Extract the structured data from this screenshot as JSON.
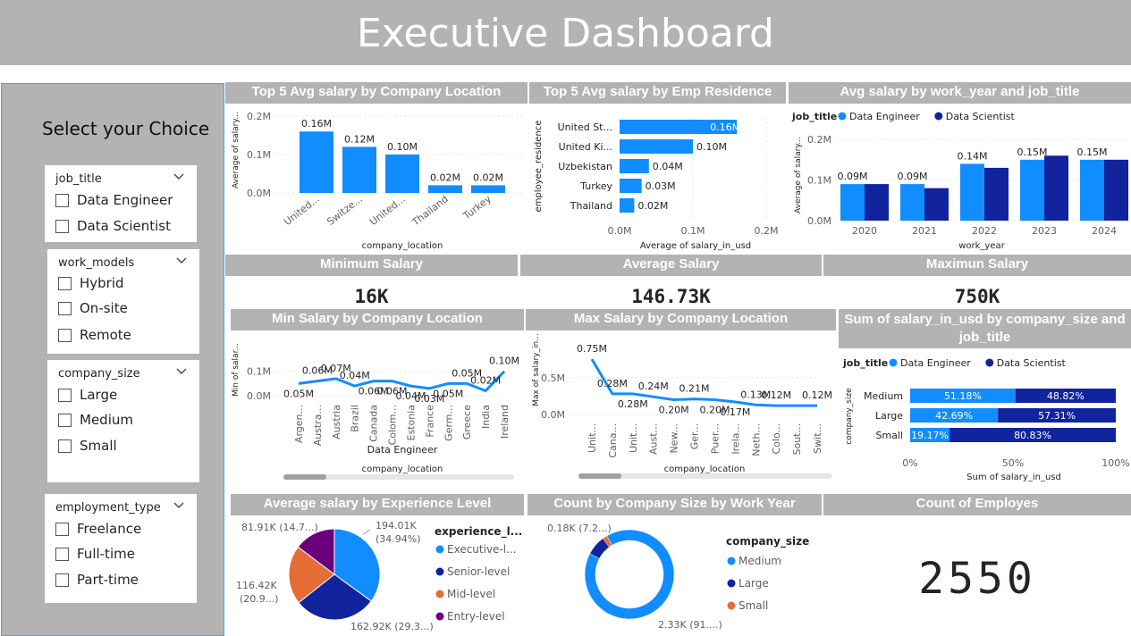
{
  "page": {
    "title": "Executive Dashboard"
  },
  "colors": {
    "primary": "#118dff",
    "dark": "#12239e",
    "orange": "#e66c37",
    "purple": "#6b007b",
    "header_bg": "#b3b3b3"
  },
  "sidebar": {
    "heading": "Select your Choice",
    "slicers": [
      {
        "title": "job_title",
        "options": [
          "Data Engineer",
          "Data Scientist"
        ]
      },
      {
        "title": "work_models",
        "options": [
          "Hybrid",
          "On-site",
          "Remote"
        ]
      },
      {
        "title": "company_size",
        "options": [
          "Large",
          "Medium",
          "Small"
        ]
      },
      {
        "title": "employment_type",
        "options": [
          "Freelance",
          "Full-time",
          "Part-time"
        ]
      }
    ]
  },
  "headers": {
    "top_loc": "Top 5 Avg salary by Company Location",
    "top_res": "Top 5 Avg salary by Emp Residence",
    "year_job": "Avg salary by work_year and job_title",
    "min_sal": "Minimum Salary",
    "avg_sal": "Average Salary",
    "max_sal": "Maximun Salary",
    "min_loc": "Min Salary by Company Location",
    "max_loc": "Max Salary by Company Location",
    "size_job": "Sum of salary_in_usd by company_size and job_title",
    "exp": "Average salary by Experience Level",
    "count_size": "Count by Company Size by Work Year",
    "count_emp": "Count of Employes"
  },
  "kpis": {
    "min": "16K",
    "avg": "146.73K",
    "max": "750K",
    "count": "2550"
  },
  "chart_data": [
    {
      "id": "top_loc",
      "type": "bar",
      "categories": [
        "United...",
        "Switze...",
        "United...",
        "Thailand",
        "Turkey"
      ],
      "values": [
        0.16,
        0.12,
        0.1,
        0.02,
        0.02
      ],
      "data_labels": [
        "0.16M",
        "0.12M",
        "0.10M",
        "0.02M",
        "0.02M"
      ],
      "xlabel": "company_location",
      "ylabel": "Average of salary...",
      "ylim": [
        0,
        0.2
      ],
      "yticks": [
        "0.0M",
        "0.1M",
        "0.2M"
      ]
    },
    {
      "id": "top_res",
      "type": "bar",
      "categories": [
        "United St...",
        "United Ki...",
        "Uzbekistan",
        "Turkey",
        "Thailand"
      ],
      "values": [
        0.16,
        0.1,
        0.04,
        0.03,
        0.02
      ],
      "data_labels": [
        "0.16M",
        "0.10M",
        "0.04M",
        "0.03M",
        "0.02M"
      ],
      "xlabel": "Average of salary_in_usd",
      "ylabel": "employee_residence",
      "xlim": [
        0,
        0.2
      ],
      "xticks": [
        "0.0M",
        "0.1M",
        "0.2M"
      ]
    },
    {
      "id": "year_job",
      "type": "bar",
      "legend_title": "job_title",
      "categories": [
        "2020",
        "2021",
        "2022",
        "2023",
        "2024"
      ],
      "series": [
        {
          "name": "Data Engineer",
          "values": [
            0.09,
            0.09,
            0.14,
            0.15,
            0.15
          ],
          "labels": [
            "0.09M",
            "0.09M",
            "0.14M",
            "0.15M",
            "0.15M"
          ]
        },
        {
          "name": "Data Scientist",
          "values": [
            0.09,
            0.08,
            0.13,
            0.16,
            0.15
          ]
        }
      ],
      "xlabel": "work_year",
      "ylabel": "Average of salary...",
      "ylim": [
        0,
        0.22
      ],
      "yticks": [
        "0.0M",
        "0.1M",
        "0.2M"
      ]
    },
    {
      "id": "min_loc",
      "type": "line",
      "categories": [
        "Argen...",
        "Austra...",
        "Austria",
        "Brazil",
        "Canada",
        "Colom...",
        "Estonia",
        "France",
        "Germ...",
        "Greece",
        "India",
        "Ireland"
      ],
      "values": [
        0.05,
        0.06,
        0.07,
        0.04,
        0.06,
        0.06,
        0.04,
        0.03,
        0.05,
        0.05,
        0.02,
        0.1
      ],
      "data_labels": [
        "0.05M",
        "0.06M",
        "0.07M",
        "0.04M",
        "0.06M",
        "0.06M",
        "0.04M",
        "0.03M",
        "0.05M",
        "0.05M",
        "0.02M",
        "0.10M"
      ],
      "xlabel": "company_location",
      "ylabel": "Min of salar...",
      "subtitle": "Data Engineer",
      "ylim": [
        0,
        0.11
      ],
      "yticks": [
        "0.0M",
        "0.1M"
      ]
    },
    {
      "id": "max_loc",
      "type": "line",
      "categories": [
        "Unit...",
        "Cana...",
        "Unit...",
        "Aust...",
        "New...",
        "Ger...",
        "Puer...",
        "Irela...",
        "Neth...",
        "Colo...",
        "Sout...",
        "Swit..."
      ],
      "values": [
        0.75,
        0.28,
        0.28,
        0.24,
        0.2,
        0.21,
        0.2,
        0.17,
        0.13,
        0.12,
        0.12,
        0.12
      ],
      "data_labels": [
        "0.75M",
        "0.28M",
        "0.28M",
        "0.24M",
        "0.20M",
        "0.21M",
        "0.20M",
        "0.17M",
        "0.13M",
        "0.12M",
        "",
        "0.12M"
      ],
      "xlabel": "company_location",
      "ylabel": "Max of salary_in...",
      "ylim": [
        0,
        0.8
      ],
      "yticks": [
        "0.0M",
        "0.5M"
      ]
    },
    {
      "id": "size_job",
      "type": "bar",
      "legend_title": "job_title",
      "categories": [
        "Medium",
        "Large",
        "Small"
      ],
      "series": [
        {
          "name": "Data Engineer",
          "values": [
            51.18,
            42.69,
            19.17
          ],
          "labels": [
            "51.18%",
            "42.69%",
            "19.17%"
          ]
        },
        {
          "name": "Data Scientist",
          "values": [
            48.82,
            57.31,
            80.83
          ],
          "labels": [
            "48.82%",
            "57.31%",
            "80.83%"
          ]
        }
      ],
      "xlabel": "Sum of salary_in_usd",
      "ylabel": "company_size",
      "xticks": [
        "0%",
        "50%",
        "100%"
      ]
    },
    {
      "id": "exp",
      "type": "pie",
      "legend_title": "experience_l...",
      "categories": [
        "Executive-l...",
        "Senior-level",
        "Mid-level",
        "Entry-level"
      ],
      "values": [
        34.94,
        29.3,
        20.9,
        14.7
      ],
      "labels": [
        [
          "194.01K",
          "(34.94%)"
        ],
        [
          "162.92K (29.3...)"
        ],
        [
          "116.42K",
          "(20.9...)"
        ],
        [
          "81.91K (14.7...)"
        ]
      ]
    },
    {
      "id": "count_size",
      "type": "pie",
      "legend_title": "company_size",
      "categories": [
        "Medium",
        "Large",
        "Small"
      ],
      "values": [
        91.2,
        7.2,
        1.6
      ],
      "labels": [
        "2.33K (91....)",
        "0.18K (7.2...)"
      ]
    }
  ]
}
